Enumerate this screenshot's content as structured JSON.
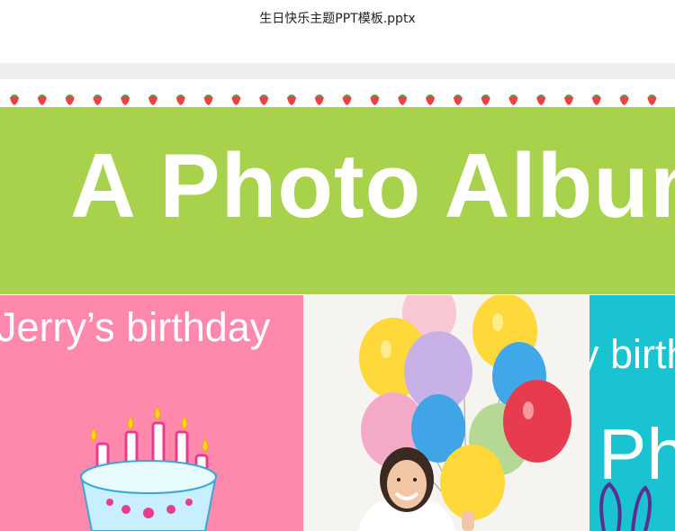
{
  "window": {
    "title": "生日快乐主题PPT模板.pptx"
  },
  "slide": {
    "headline": "A Photo Album",
    "pink_caption": "Jerry’s birthday",
    "teal_caption": "y birthday",
    "teal_big_text": "Ph"
  },
  "colors": {
    "green": "#a8d24b",
    "pink": "#ff88ad",
    "teal": "#19c3d1",
    "berry": "#e8414c"
  },
  "icons": [
    "strawberry-icon",
    "birthday-cake-icon",
    "balloons-icon",
    "girl-photo",
    "bunny-ears-icon"
  ]
}
